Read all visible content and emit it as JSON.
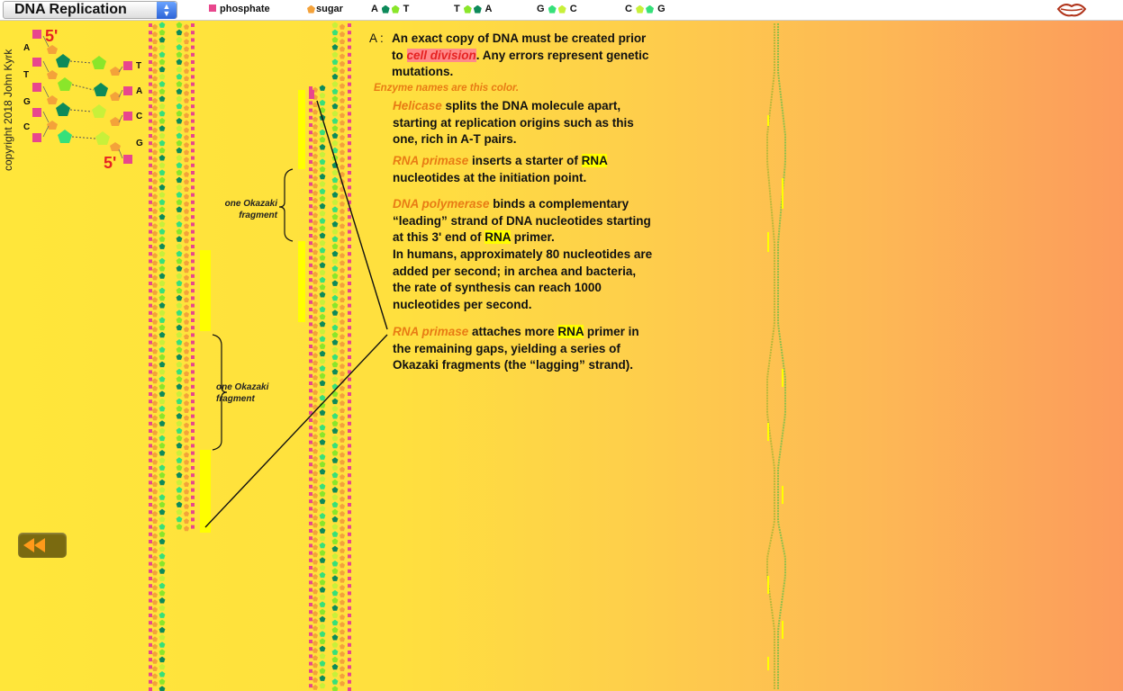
{
  "app": {
    "title": "DNA Replication",
    "copyright": "copyright 2018 John Kyrk"
  },
  "legend": {
    "phosphate": "phosphate",
    "sugar": "sugar",
    "pairs": [
      {
        "left": "A",
        "right": "T"
      },
      {
        "left": "T",
        "right": "A"
      },
      {
        "left": "G",
        "right": "C"
      },
      {
        "left": "C",
        "right": "G"
      }
    ]
  },
  "mini_dna": {
    "five_prime_top": "5'",
    "five_prime_bottom": "5'",
    "left_bases": [
      "A",
      "T",
      "G",
      "C"
    ],
    "right_bases": [
      "T",
      "A",
      "C",
      "G"
    ]
  },
  "okazaki": {
    "label_line1": "one Okazaki",
    "label_line2": "fragment"
  },
  "content": {
    "label": "A :",
    "intro_1": "An exact copy of DNA must be created prior to ",
    "intro_hl": "cell division",
    "intro_2": ". Any errors represent genetic mutations.",
    "enzyme_note": "Enzyme names are this color.",
    "helicase_name": "Helicase",
    "helicase_text": " splits the DNA molecule apart, starting at replication origins such as this one, rich in A-T pairs.",
    "primase_name": "RNA primase",
    "primase_text_1": " inserts a starter of ",
    "rna": "RNA",
    "primase_text_2": " nucleotides at the initiation point.",
    "polymerase_name": "DNA polymerase",
    "polymerase_text_1": " binds a complementary “leading” strand of DNA nucleotides starting at this 3' end of ",
    "polymerase_text_2": " primer.",
    "rate_text": "In humans, approximately 80 nucleotides are added per second; in archea and bacteria, the rate of synthesis can reach 1000 nucleotides per second.",
    "primase2_name": "RNA primase",
    "primase2_text_1": " attaches more ",
    "primase2_text_2": " primer in the remaining gaps, yielding a series of Okazaki fragments (the “lagging” strand)."
  },
  "colors": {
    "phosphate": "#e8478d",
    "sugar": "#f4a23a",
    "adenine": "#0d8a5a",
    "thymine": "#8ae62a",
    "guanine": "#36e07a",
    "cytosine": "#c8f03a",
    "enzyme": "#e87b14"
  }
}
